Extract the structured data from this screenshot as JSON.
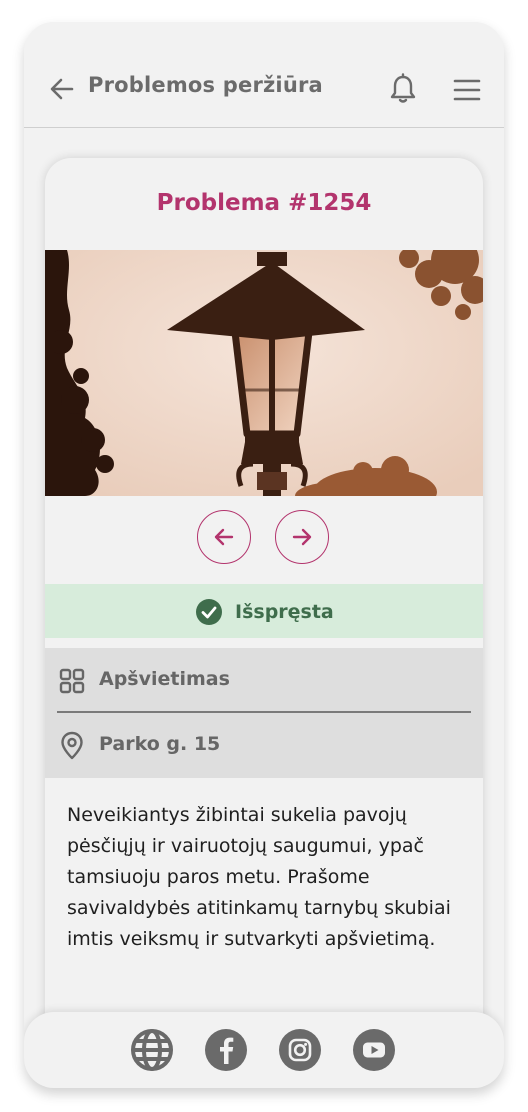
{
  "header": {
    "title": "Problemos peržiūra",
    "back_icon": "arrow-left-icon",
    "bell_icon": "bell-icon",
    "menu_icon": "hamburger-menu-icon"
  },
  "issue": {
    "title": "Problema #1254",
    "photo_icon": "street-lamp-photo",
    "status": "Išspręsta",
    "status_icon": "check-circle-icon",
    "status_color": "#3f6d4c",
    "category": "Apšvietimas",
    "category_icon": "grid-icon",
    "address": "Parko g. 15",
    "address_icon": "location-pin-icon",
    "description": "Neveikiantys žibintai sukelia pavojų pėsčiųjų ir vairuotojų saugumui, ypač tamsiuoju paros metu. Prašome savivaldybės atitinkamų tarnybų skubiai imtis veiksmų ir sutvarkyti apšvietimą."
  },
  "gallery": {
    "prev_icon": "arrow-left-circle-icon",
    "next_icon": "arrow-right-circle-icon"
  },
  "footer": {
    "icons": [
      "globe-icon",
      "facebook-icon",
      "instagram-icon",
      "youtube-icon"
    ]
  },
  "colors": {
    "accent": "#b3346d",
    "status_bg": "#d7ecdb",
    "info_bg": "#dedede",
    "background": "#f2f2f2"
  }
}
